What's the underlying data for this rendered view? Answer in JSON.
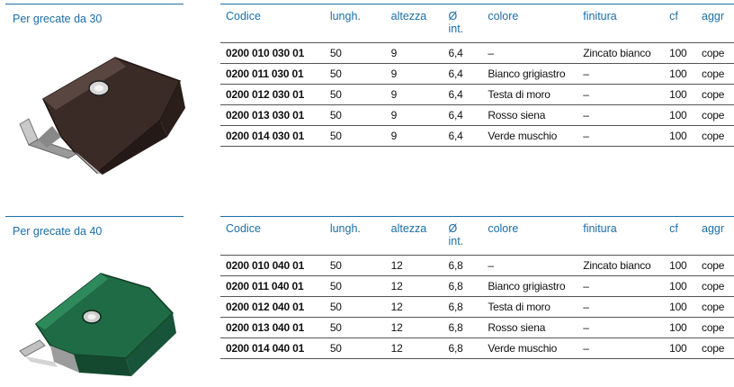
{
  "sections": [
    {
      "title": "Per grecate da 30",
      "headers": [
        "Codice",
        "lungh.",
        "altezza",
        "Ø int.",
        "colore",
        "finitura",
        "cf",
        "aggr"
      ],
      "rows": [
        [
          "0200 010 030 01",
          "50",
          "9",
          "6,4",
          "–",
          "Zincato bianco",
          "100",
          "cope"
        ],
        [
          "0200 011 030 01",
          "50",
          "9",
          "6,4",
          "Bianco grigiastro",
          "–",
          "100",
          "cope"
        ],
        [
          "0200 012 030 01",
          "50",
          "9",
          "6,4",
          "Testa di moro",
          "–",
          "100",
          "cope"
        ],
        [
          "0200 013 030 01",
          "50",
          "9",
          "6,4",
          "Rosso siena",
          "–",
          "100",
          "cope"
        ],
        [
          "0200 014 030 01",
          "50",
          "9",
          "6,4",
          "Verde muschio",
          "–",
          "100",
          "cope"
        ]
      ],
      "product_color": "#3a2b27"
    },
    {
      "title": "Per grecate da 40",
      "headers": [
        "Codice",
        "lungh.",
        "altezza",
        "Ø int.",
        "colore",
        "finitura",
        "cf",
        "aggr"
      ],
      "rows": [
        [
          "0200 010 040 01",
          "50",
          "12",
          "6,8",
          "–",
          "Zincato bianco",
          "100",
          "cope"
        ],
        [
          "0200 011 040 01",
          "50",
          "12",
          "6,8",
          "Bianco grigiastro",
          "–",
          "100",
          "cope"
        ],
        [
          "0200 012 040 01",
          "50",
          "12",
          "6,8",
          "Testa di moro",
          "–",
          "100",
          "cope"
        ],
        [
          "0200 013 040 01",
          "50",
          "12",
          "6,8",
          "Rosso siena",
          "–",
          "100",
          "cope"
        ],
        [
          "0200 014 040 01",
          "50",
          "12",
          "6,8",
          "Verde muschio",
          "–",
          "100",
          "cope"
        ]
      ],
      "product_color": "#1f6b45"
    }
  ],
  "accent_color": "#1b6ea8"
}
